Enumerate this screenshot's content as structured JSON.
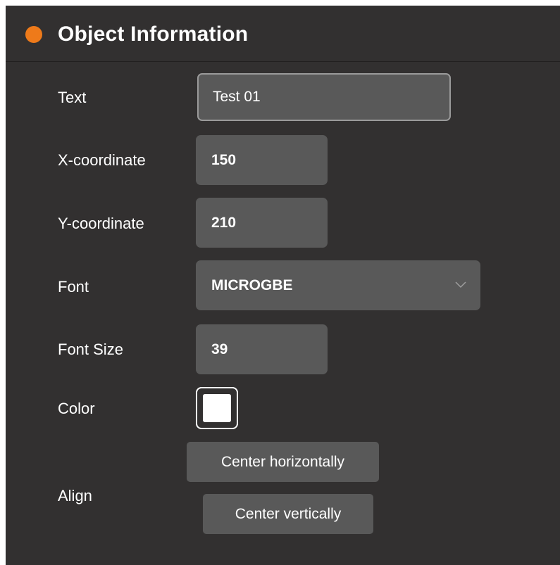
{
  "header": {
    "title": "Object Information",
    "dot_color": "#ee7a1a"
  },
  "fields": {
    "text": {
      "label": "Text",
      "value": "Test  01"
    },
    "x": {
      "label": "X-coordinate",
      "value": "150"
    },
    "y": {
      "label": "Y-coordinate",
      "value": "210"
    },
    "font": {
      "label": "Font",
      "value": "MICROGBE",
      "icon": "chevron-down-icon"
    },
    "font_size": {
      "label": "Font Size",
      "value": "39"
    },
    "color": {
      "label": "Color",
      "value": "#ffffff"
    },
    "align": {
      "label": "Align",
      "center_horizontally": "Center horizontally",
      "center_vertically": "Center vertically"
    }
  },
  "colors": {
    "panel_bg": "#323030",
    "field_bg": "#595959",
    "accent": "#ee7a1a"
  }
}
